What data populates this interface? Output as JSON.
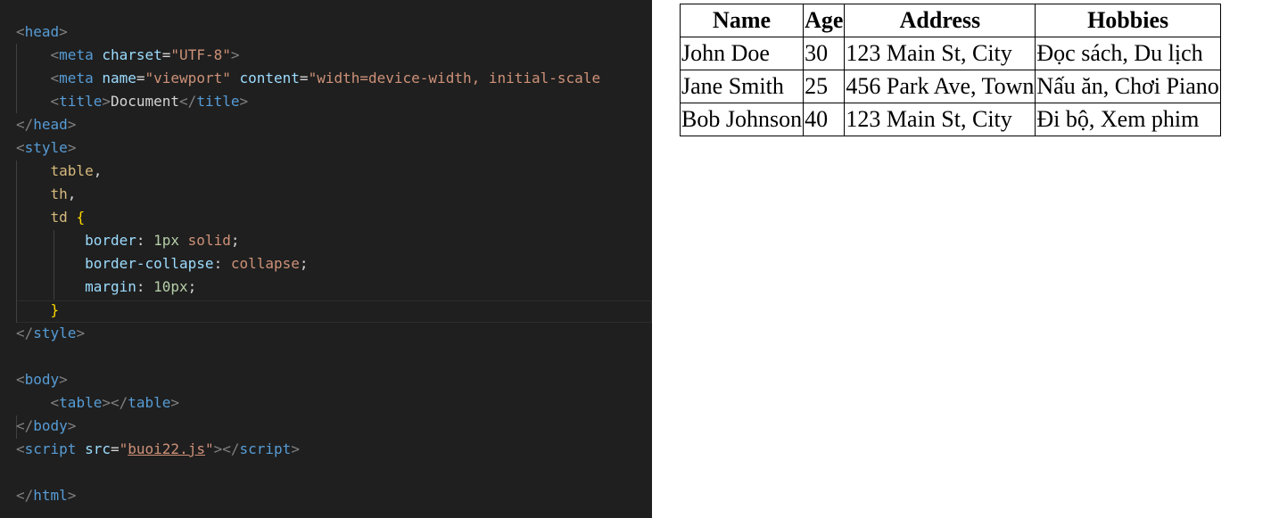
{
  "editor": {
    "code_lines": [
      [
        {
          "t": "<",
          "c": "t-punct"
        },
        {
          "t": "head",
          "c": "t-tag"
        },
        {
          "t": ">",
          "c": "t-punct"
        }
      ],
      [
        {
          "t": "    ",
          "c": "t-text"
        },
        {
          "t": "<",
          "c": "t-punct"
        },
        {
          "t": "meta",
          "c": "t-tag"
        },
        {
          "t": " ",
          "c": "t-text"
        },
        {
          "t": "charset",
          "c": "t-attr"
        },
        {
          "t": "=",
          "c": "t-text"
        },
        {
          "t": "\"UTF-8\"",
          "c": "t-str"
        },
        {
          "t": ">",
          "c": "t-punct"
        }
      ],
      [
        {
          "t": "    ",
          "c": "t-text"
        },
        {
          "t": "<",
          "c": "t-punct"
        },
        {
          "t": "meta",
          "c": "t-tag"
        },
        {
          "t": " ",
          "c": "t-text"
        },
        {
          "t": "name",
          "c": "t-attr"
        },
        {
          "t": "=",
          "c": "t-text"
        },
        {
          "t": "\"viewport\"",
          "c": "t-str"
        },
        {
          "t": " ",
          "c": "t-text"
        },
        {
          "t": "content",
          "c": "t-attr"
        },
        {
          "t": "=",
          "c": "t-text"
        },
        {
          "t": "\"width=device-width, initial-scale",
          "c": "t-str"
        }
      ],
      [
        {
          "t": "    ",
          "c": "t-text"
        },
        {
          "t": "<",
          "c": "t-punct"
        },
        {
          "t": "title",
          "c": "t-tag"
        },
        {
          "t": ">",
          "c": "t-punct"
        },
        {
          "t": "Document",
          "c": "t-text"
        },
        {
          "t": "</",
          "c": "t-punct"
        },
        {
          "t": "title",
          "c": "t-tag"
        },
        {
          "t": ">",
          "c": "t-punct"
        }
      ],
      [
        {
          "t": "</",
          "c": "t-punct"
        },
        {
          "t": "head",
          "c": "t-tag"
        },
        {
          "t": ">",
          "c": "t-punct"
        }
      ],
      [
        {
          "t": "<",
          "c": "t-punct"
        },
        {
          "t": "style",
          "c": "t-tag"
        },
        {
          "t": ">",
          "c": "t-punct"
        }
      ],
      [
        {
          "t": "    ",
          "c": "t-text"
        },
        {
          "t": "table",
          "c": "t-sel"
        },
        {
          "t": ",",
          "c": "t-text"
        }
      ],
      [
        {
          "t": "    ",
          "c": "t-text"
        },
        {
          "t": "th",
          "c": "t-sel"
        },
        {
          "t": ",",
          "c": "t-text"
        }
      ],
      [
        {
          "t": "    ",
          "c": "t-text"
        },
        {
          "t": "td",
          "c": "t-sel"
        },
        {
          "t": " ",
          "c": "t-text"
        },
        {
          "t": "{",
          "c": "t-brace"
        }
      ],
      [
        {
          "t": "        ",
          "c": "t-text"
        },
        {
          "t": "border",
          "c": "t-attr"
        },
        {
          "t": ": ",
          "c": "t-text"
        },
        {
          "t": "1px",
          "c": "t-num"
        },
        {
          "t": " ",
          "c": "t-text"
        },
        {
          "t": "solid",
          "c": "t-str"
        },
        {
          "t": ";",
          "c": "t-text"
        }
      ],
      [
        {
          "t": "        ",
          "c": "t-text"
        },
        {
          "t": "border-collapse",
          "c": "t-attr"
        },
        {
          "t": ": ",
          "c": "t-text"
        },
        {
          "t": "collapse",
          "c": "t-str"
        },
        {
          "t": ";",
          "c": "t-text"
        }
      ],
      [
        {
          "t": "        ",
          "c": "t-text"
        },
        {
          "t": "margin",
          "c": "t-attr"
        },
        {
          "t": ": ",
          "c": "t-text"
        },
        {
          "t": "10px",
          "c": "t-num"
        },
        {
          "t": ";",
          "c": "t-text"
        }
      ],
      [
        {
          "t": "    ",
          "c": "t-text"
        },
        {
          "t": "}",
          "c": "t-brace"
        }
      ],
      [
        {
          "t": "</",
          "c": "t-punct"
        },
        {
          "t": "style",
          "c": "t-tag"
        },
        {
          "t": ">",
          "c": "t-punct"
        }
      ],
      [],
      [
        {
          "t": "<",
          "c": "t-punct"
        },
        {
          "t": "body",
          "c": "t-tag"
        },
        {
          "t": ">",
          "c": "t-punct"
        }
      ],
      [
        {
          "t": "    ",
          "c": "t-text"
        },
        {
          "t": "<",
          "c": "t-punct"
        },
        {
          "t": "table",
          "c": "t-tag"
        },
        {
          "t": "></",
          "c": "t-punct"
        },
        {
          "t": "table",
          "c": "t-tag"
        },
        {
          "t": ">",
          "c": "t-punct"
        }
      ],
      [
        {
          "t": "</",
          "c": "t-punct"
        },
        {
          "t": "body",
          "c": "t-tag"
        },
        {
          "t": ">",
          "c": "t-punct"
        }
      ],
      [
        {
          "t": "<",
          "c": "t-punct"
        },
        {
          "t": "script",
          "c": "t-tag"
        },
        {
          "t": " ",
          "c": "t-text"
        },
        {
          "t": "src",
          "c": "t-attr"
        },
        {
          "t": "=",
          "c": "t-text"
        },
        {
          "t": "\"",
          "c": "t-str"
        },
        {
          "t": "buoi22.js",
          "c": "t-str t-link"
        },
        {
          "t": "\"",
          "c": "t-str"
        },
        {
          "t": "></",
          "c": "t-punct"
        },
        {
          "t": "script",
          "c": "t-tag"
        },
        {
          "t": ">",
          "c": "t-punct"
        }
      ],
      [],
      [
        {
          "t": "</",
          "c": "t-punct"
        },
        {
          "t": "html",
          "c": "t-tag"
        },
        {
          "t": ">",
          "c": "t-punct"
        }
      ]
    ]
  },
  "preview": {
    "table": {
      "headers": [
        "Name",
        "Age",
        "Address",
        "Hobbies"
      ],
      "rows": [
        [
          "John Doe",
          "30",
          "123 Main St, City",
          "Đọc sách, Du lịch"
        ],
        [
          "Jane Smith",
          "25",
          "456 Park Ave, Town",
          "Nấu ăn, Chơi Piano"
        ],
        [
          "Bob Johnson",
          "40",
          "123 Main St, City",
          "Đi bộ, Xem phim"
        ]
      ]
    }
  }
}
